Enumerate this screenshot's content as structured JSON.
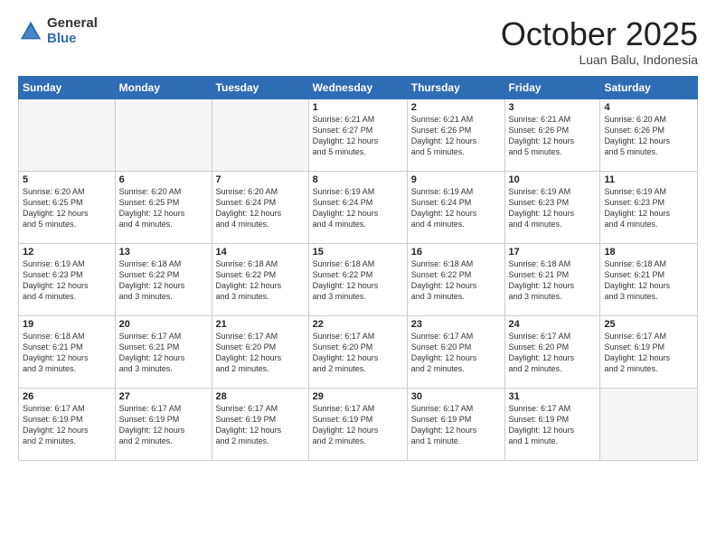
{
  "logo": {
    "general": "General",
    "blue": "Blue"
  },
  "header": {
    "month": "October 2025",
    "location": "Luan Balu, Indonesia"
  },
  "days_of_week": [
    "Sunday",
    "Monday",
    "Tuesday",
    "Wednesday",
    "Thursday",
    "Friday",
    "Saturday"
  ],
  "weeks": [
    [
      {
        "day": "",
        "info": ""
      },
      {
        "day": "",
        "info": ""
      },
      {
        "day": "",
        "info": ""
      },
      {
        "day": "1",
        "info": "Sunrise: 6:21 AM\nSunset: 6:27 PM\nDaylight: 12 hours\nand 5 minutes."
      },
      {
        "day": "2",
        "info": "Sunrise: 6:21 AM\nSunset: 6:26 PM\nDaylight: 12 hours\nand 5 minutes."
      },
      {
        "day": "3",
        "info": "Sunrise: 6:21 AM\nSunset: 6:26 PM\nDaylight: 12 hours\nand 5 minutes."
      },
      {
        "day": "4",
        "info": "Sunrise: 6:20 AM\nSunset: 6:26 PM\nDaylight: 12 hours\nand 5 minutes."
      }
    ],
    [
      {
        "day": "5",
        "info": "Sunrise: 6:20 AM\nSunset: 6:25 PM\nDaylight: 12 hours\nand 5 minutes."
      },
      {
        "day": "6",
        "info": "Sunrise: 6:20 AM\nSunset: 6:25 PM\nDaylight: 12 hours\nand 4 minutes."
      },
      {
        "day": "7",
        "info": "Sunrise: 6:20 AM\nSunset: 6:24 PM\nDaylight: 12 hours\nand 4 minutes."
      },
      {
        "day": "8",
        "info": "Sunrise: 6:19 AM\nSunset: 6:24 PM\nDaylight: 12 hours\nand 4 minutes."
      },
      {
        "day": "9",
        "info": "Sunrise: 6:19 AM\nSunset: 6:24 PM\nDaylight: 12 hours\nand 4 minutes."
      },
      {
        "day": "10",
        "info": "Sunrise: 6:19 AM\nSunset: 6:23 PM\nDaylight: 12 hours\nand 4 minutes."
      },
      {
        "day": "11",
        "info": "Sunrise: 6:19 AM\nSunset: 6:23 PM\nDaylight: 12 hours\nand 4 minutes."
      }
    ],
    [
      {
        "day": "12",
        "info": "Sunrise: 6:19 AM\nSunset: 6:23 PM\nDaylight: 12 hours\nand 4 minutes."
      },
      {
        "day": "13",
        "info": "Sunrise: 6:18 AM\nSunset: 6:22 PM\nDaylight: 12 hours\nand 3 minutes."
      },
      {
        "day": "14",
        "info": "Sunrise: 6:18 AM\nSunset: 6:22 PM\nDaylight: 12 hours\nand 3 minutes."
      },
      {
        "day": "15",
        "info": "Sunrise: 6:18 AM\nSunset: 6:22 PM\nDaylight: 12 hours\nand 3 minutes."
      },
      {
        "day": "16",
        "info": "Sunrise: 6:18 AM\nSunset: 6:22 PM\nDaylight: 12 hours\nand 3 minutes."
      },
      {
        "day": "17",
        "info": "Sunrise: 6:18 AM\nSunset: 6:21 PM\nDaylight: 12 hours\nand 3 minutes."
      },
      {
        "day": "18",
        "info": "Sunrise: 6:18 AM\nSunset: 6:21 PM\nDaylight: 12 hours\nand 3 minutes."
      }
    ],
    [
      {
        "day": "19",
        "info": "Sunrise: 6:18 AM\nSunset: 6:21 PM\nDaylight: 12 hours\nand 3 minutes."
      },
      {
        "day": "20",
        "info": "Sunrise: 6:17 AM\nSunset: 6:21 PM\nDaylight: 12 hours\nand 3 minutes."
      },
      {
        "day": "21",
        "info": "Sunrise: 6:17 AM\nSunset: 6:20 PM\nDaylight: 12 hours\nand 2 minutes."
      },
      {
        "day": "22",
        "info": "Sunrise: 6:17 AM\nSunset: 6:20 PM\nDaylight: 12 hours\nand 2 minutes."
      },
      {
        "day": "23",
        "info": "Sunrise: 6:17 AM\nSunset: 6:20 PM\nDaylight: 12 hours\nand 2 minutes."
      },
      {
        "day": "24",
        "info": "Sunrise: 6:17 AM\nSunset: 6:20 PM\nDaylight: 12 hours\nand 2 minutes."
      },
      {
        "day": "25",
        "info": "Sunrise: 6:17 AM\nSunset: 6:19 PM\nDaylight: 12 hours\nand 2 minutes."
      }
    ],
    [
      {
        "day": "26",
        "info": "Sunrise: 6:17 AM\nSunset: 6:19 PM\nDaylight: 12 hours\nand 2 minutes."
      },
      {
        "day": "27",
        "info": "Sunrise: 6:17 AM\nSunset: 6:19 PM\nDaylight: 12 hours\nand 2 minutes."
      },
      {
        "day": "28",
        "info": "Sunrise: 6:17 AM\nSunset: 6:19 PM\nDaylight: 12 hours\nand 2 minutes."
      },
      {
        "day": "29",
        "info": "Sunrise: 6:17 AM\nSunset: 6:19 PM\nDaylight: 12 hours\nand 2 minutes."
      },
      {
        "day": "30",
        "info": "Sunrise: 6:17 AM\nSunset: 6:19 PM\nDaylight: 12 hours\nand 1 minute."
      },
      {
        "day": "31",
        "info": "Sunrise: 6:17 AM\nSunset: 6:19 PM\nDaylight: 12 hours\nand 1 minute."
      },
      {
        "day": "",
        "info": ""
      }
    ]
  ]
}
